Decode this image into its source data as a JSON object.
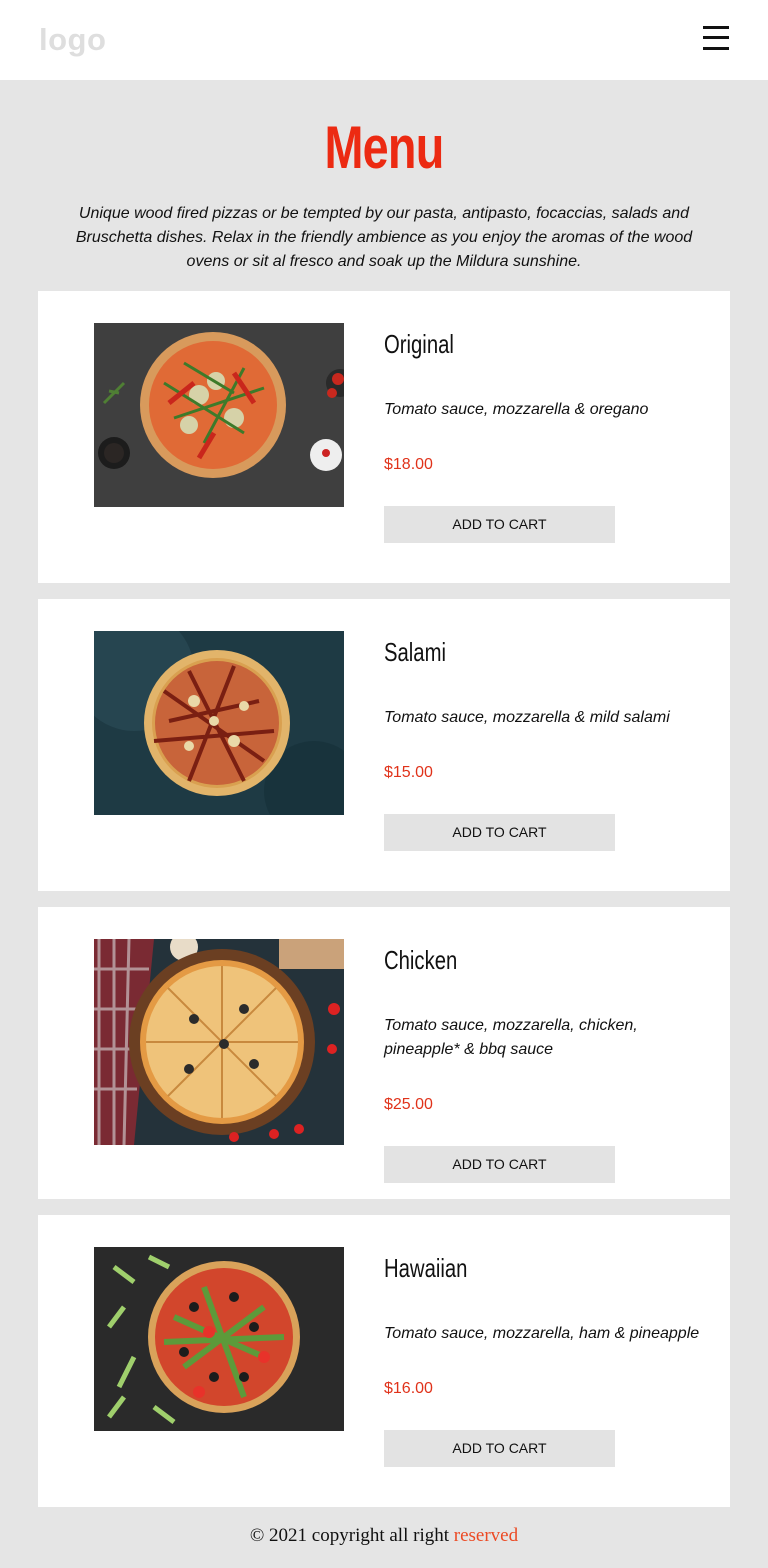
{
  "header": {
    "logo_text": "logo",
    "menu_icon": "hamburger-menu-icon"
  },
  "page": {
    "title": "Menu",
    "intro": "Unique wood fired pizzas or be tempted by our pasta, antipasto, focaccias, salads and Bruschetta dishes. Relax in the friendly ambience as you enjoy the aromas of the wood ovens or sit al fresco and soak up the Mildura sunshine."
  },
  "items": [
    {
      "name": "Original",
      "description": "Tomato sauce, mozzarella & oregano",
      "price": "$18.00",
      "button_label": "ADD TO CART"
    },
    {
      "name": "Salami",
      "description": "Tomato sauce, mozzarella & mild salami",
      "price": "$15.00",
      "button_label": "ADD TO CART"
    },
    {
      "name": "Chicken",
      "description": "Tomato sauce, mozzarella, chicken, pineapple* & bbq sauce",
      "price": "$25.00",
      "button_label": "ADD TO CART"
    },
    {
      "name": "Hawaiian",
      "description": "Tomato sauce, mozzarella, ham & pineapple",
      "price": "$16.00",
      "button_label": "ADD TO CART"
    }
  ],
  "footer": {
    "text": "© 2021 copyright all right",
    "accent_text": "reserved"
  },
  "colors": {
    "accent": "#ec2a12",
    "price": "#e0321a",
    "background": "#e5e5e5",
    "button": "#e3e3e3"
  }
}
